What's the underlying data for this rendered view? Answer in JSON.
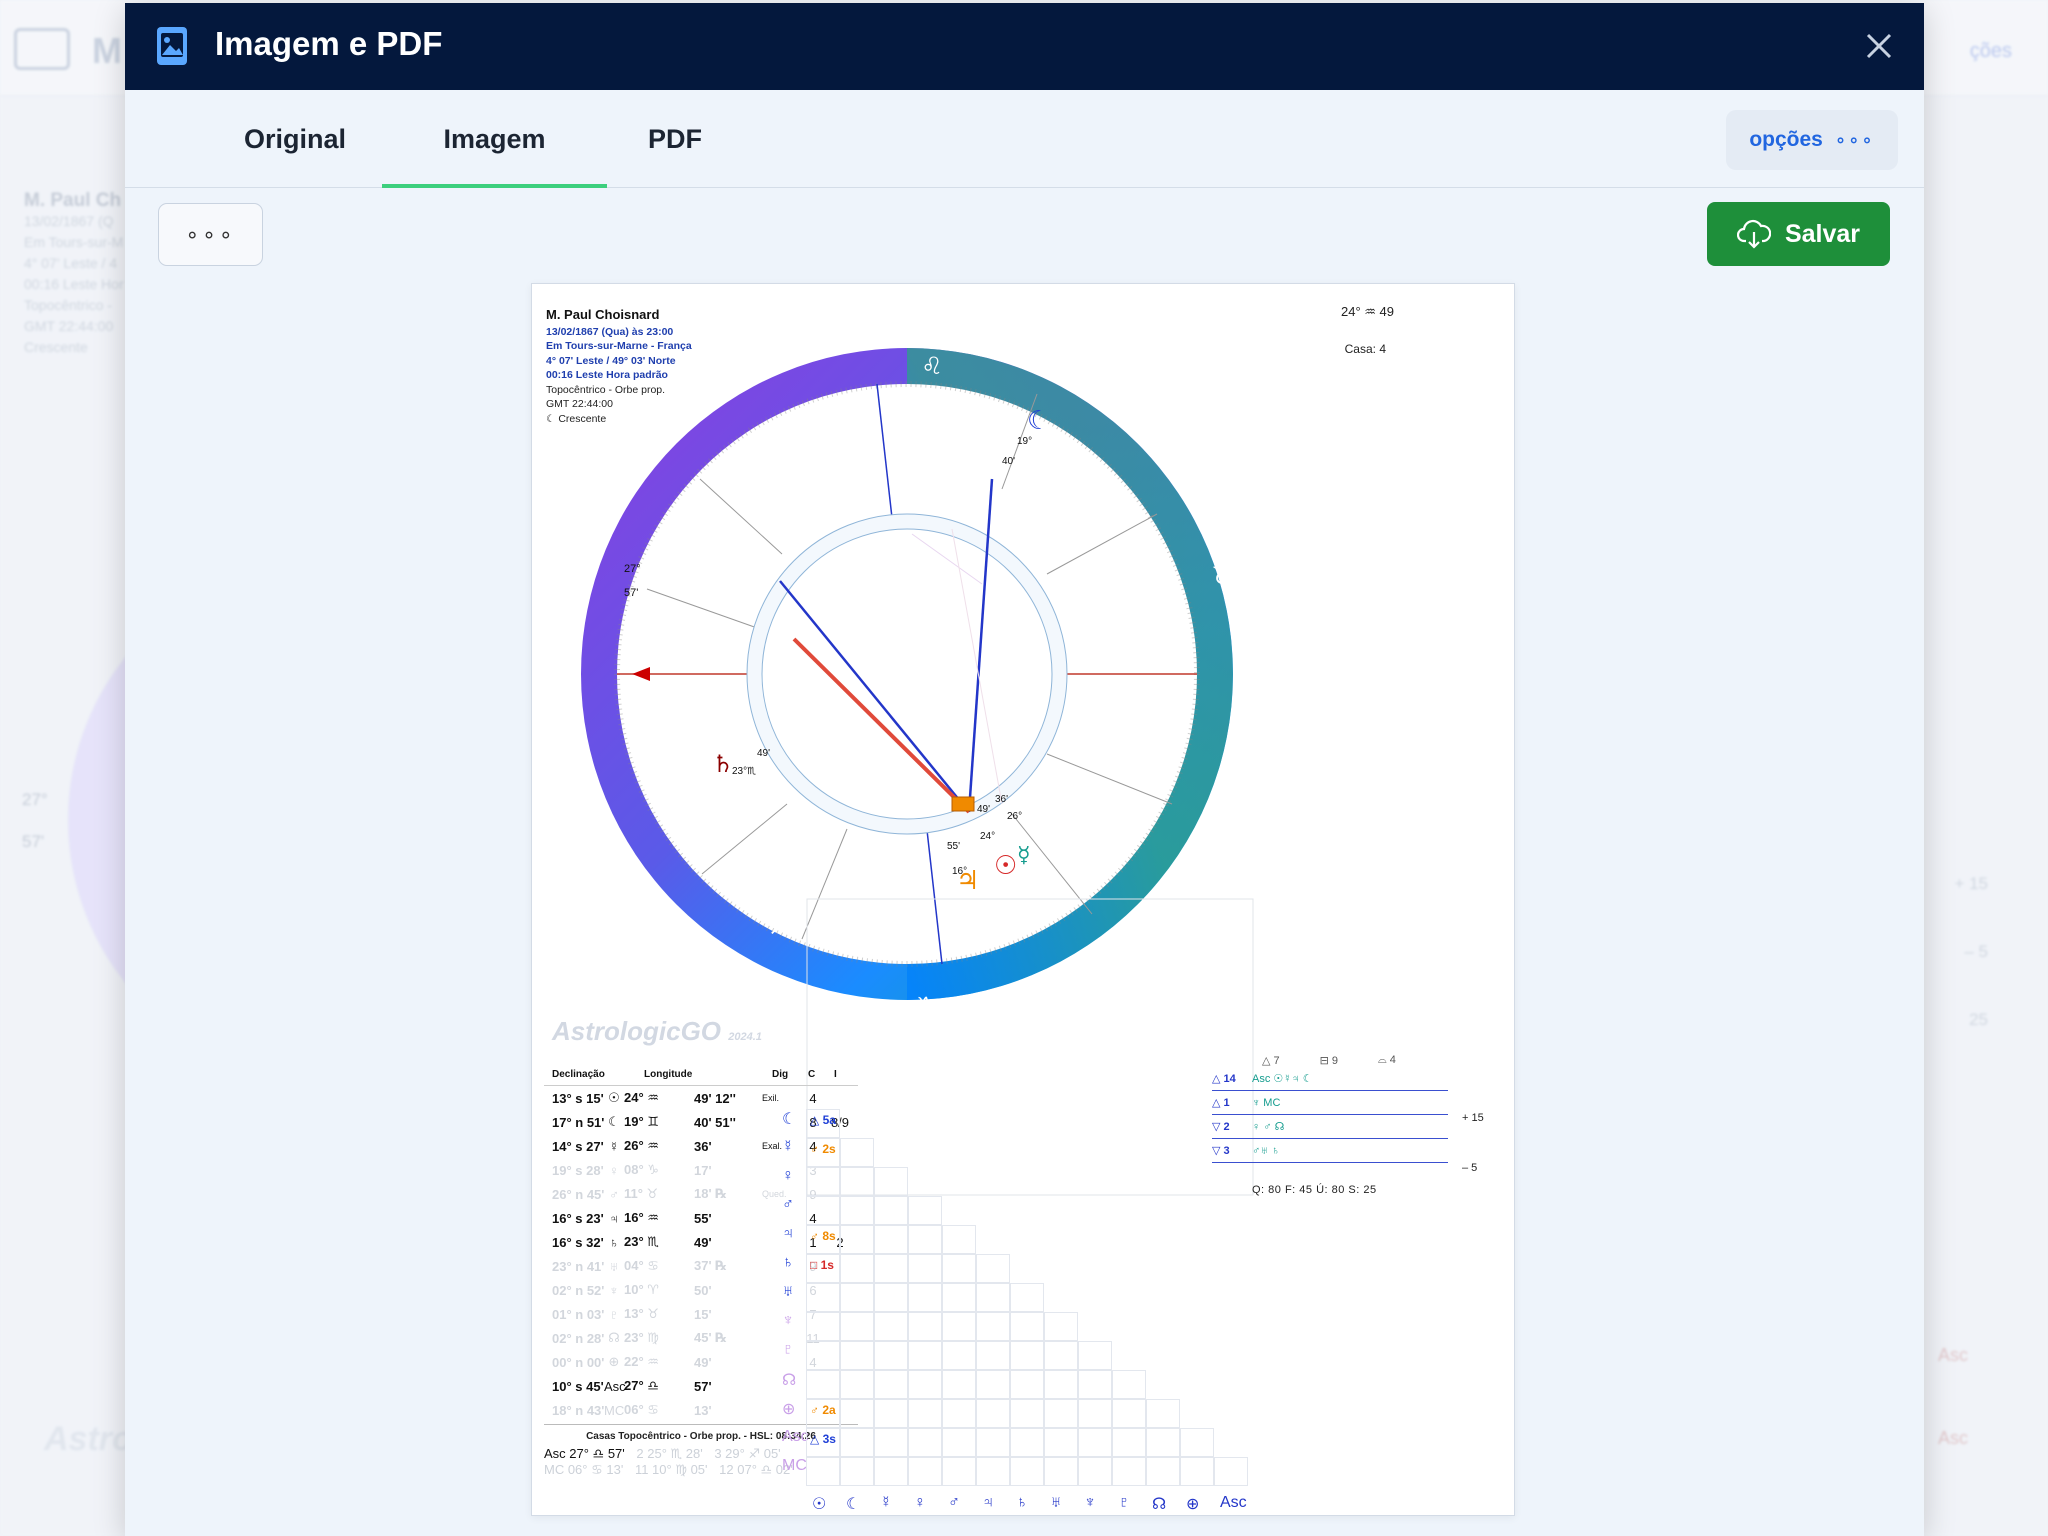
{
  "background": {
    "app_title": "M",
    "options_label": "ções",
    "person": "M. Paul Ch",
    "lines": [
      "13/02/1867 (Q",
      "Em Tours-sur-M",
      "4° 07' Leste / 4",
      "00:16 Leste Hor",
      "Topocêntrico -",
      "GMT 22:44:00",
      "Crescente"
    ],
    "asc_deg": "27°",
    "asc_min": "57'",
    "right_vals": [
      "+ 15",
      "– 5",
      "25"
    ],
    "asc_a": "Asc",
    "asc_b": "Asc",
    "watermark": "Astro"
  },
  "modal": {
    "title": "Imagem e PDF",
    "tabs": [
      {
        "label": "Original",
        "active": false
      },
      {
        "label": "Imagem",
        "active": true
      },
      {
        "label": "PDF",
        "active": false
      }
    ],
    "options_label": "opções",
    "options_dots": "∘∘∘",
    "more_dots": "∘∘∘",
    "save_label": "Salvar"
  },
  "chart": {
    "name": "M. Paul Choisnard",
    "info": [
      {
        "text": "13/02/1867 (Qua) às 23:00",
        "blue": true
      },
      {
        "text": "Em Tours-sur-Marne - França",
        "blue": true
      },
      {
        "text": "4° 07' Leste / 49° 03' Norte",
        "blue": true
      },
      {
        "text": "00:16 Leste Hora padrão",
        "blue": true
      },
      {
        "text": "Topocêntrico - Orbe prop.",
        "blue": false
      },
      {
        "text": "GMT 22:44:00",
        "blue": false
      },
      {
        "text": "☾ Crescente",
        "blue": false
      }
    ],
    "sun_pos": "24° ♒ 49",
    "casa": "Casa: 4",
    "asc_label": "Asc",
    "asc_deg": "27°",
    "asc_min": "57'",
    "watermark": "AstrologicGO",
    "watermark_ver": "2024.1",
    "accent_colors": {
      "red": "#d62828",
      "blue": "#1f3fd6",
      "teal": "#149c8e",
      "purple": "#6a3fd6",
      "orange": "#f08a00"
    }
  },
  "decl_table": {
    "headers": [
      "Declinação",
      "Longitude",
      "Dig",
      "C",
      "I"
    ],
    "rows": [
      {
        "decl": "13° s 15'",
        "glyph": "☉",
        "lon": "24° ♒",
        "min": "49' 12''",
        "dig": "Exil.",
        "c": "4",
        "i": "",
        "dim": false
      },
      {
        "decl": "17° n 51'",
        "glyph": "☾",
        "lon": "19° ♊",
        "min": "40' 51''",
        "dig": "",
        "c": "8",
        "i": "8/9",
        "dim": false
      },
      {
        "decl": "14° s 27'",
        "glyph": "☿",
        "lon": "26° ♒",
        "min": "36'",
        "dig": "Exal.",
        "c": "4",
        "i": "",
        "dim": false
      },
      {
        "decl": "19° s 28'",
        "glyph": "♀",
        "lon": "08° ♑",
        "min": "17'",
        "dig": "",
        "c": "3",
        "i": "",
        "dim": true
      },
      {
        "decl": "26° n 45'",
        "glyph": "♂",
        "lon": "11° ♉",
        "min": "18' ℞",
        "dig": "Qued.",
        "c": "9",
        "i": "",
        "dim": true
      },
      {
        "decl": "16° s 23'",
        "glyph": "♃",
        "lon": "16° ♒",
        "min": "55'",
        "dig": "",
        "c": "4",
        "i": "",
        "dim": false
      },
      {
        "decl": "16° s 32'",
        "glyph": "♄",
        "lon": "23° ♏",
        "min": "49'",
        "dig": "",
        "c": "1",
        "i": "2",
        "dim": false
      },
      {
        "decl": "23° n 41'",
        "glyph": "♅",
        "lon": "04° ♋",
        "min": "37' ℞",
        "dig": "",
        "c": "9",
        "i": "",
        "dim": true
      },
      {
        "decl": "02° n 52'",
        "glyph": "♆",
        "lon": "10° ♈",
        "min": "50'",
        "dig": "",
        "c": "6",
        "i": "",
        "dim": true
      },
      {
        "decl": "01° n 03'",
        "glyph": "♇",
        "lon": "13° ♉",
        "min": "15'",
        "dig": "",
        "c": "7",
        "i": "",
        "dim": true
      },
      {
        "decl": "02° n 28'",
        "glyph": "☊",
        "lon": "23° ♍",
        "min": "45' ℞",
        "dig": "",
        "c": "11",
        "i": "",
        "dim": true
      },
      {
        "decl": "00° n 00'",
        "glyph": "⊕",
        "lon": "22° ♒",
        "min": "49'",
        "dig": "",
        "c": "4",
        "i": "",
        "dim": true
      },
      {
        "decl": "10° s 45'",
        "glyph": "Asc",
        "lon": "27° ♎",
        "min": "57'",
        "dig": "",
        "c": "",
        "i": "",
        "dim": false
      },
      {
        "decl": "18° n 43'",
        "glyph": "MC",
        "lon": "06° ♋",
        "min": "13'",
        "dig": "",
        "c": "",
        "i": "",
        "dim": true
      }
    ],
    "casas_caption": "Casas Topocêntrico - Orbe prop. - HSL: 08:34:26",
    "casas_asc": "Asc 27° ♎ 57'",
    "casas_dim": [
      "2 25° ♏ 28'",
      "3 29° ♐ 05'"
    ],
    "casas_mc": "MC 06° ♋ 13'",
    "casas_dim2": [
      "11 10° ♍ 05'",
      "12 07° ♎ 02'"
    ]
  },
  "elements": {
    "top": [
      "△ 7",
      "⊟ 9",
      "⌓ 4"
    ],
    "rows": [
      {
        "label": "△ 14",
        "val": "Asc  ☉☿♃  ☾"
      },
      {
        "label": "△ 1",
        "val": "♆   MC"
      },
      {
        "label": "▽ 2",
        "val": "♀   ♂   ☊"
      },
      {
        "label": "▽ 3",
        "val": "♂♅  ♄"
      }
    ],
    "plus": "+  15",
    "minus": "–   5",
    "quad": "Q: 80   F: 45   Ú: 80   S: 25"
  },
  "aspects_grid": {
    "row_labels": [
      "☾",
      "☿",
      "♀",
      "♂",
      "♃",
      "♄",
      "♅",
      "♆",
      "♇",
      "☊",
      "⊕",
      "Asc",
      "MC"
    ],
    "cells": [
      {
        "row": 0,
        "text": "△ 5a",
        "color": "#1f3fd6"
      },
      {
        "row": 1,
        "text": "♂ 2s",
        "color": "#f08a00"
      },
      {
        "row": 4,
        "text": "♂ 8s",
        "color": "#f08a00"
      },
      {
        "row": 5,
        "text": "□ 1s",
        "color": "#d62828"
      },
      {
        "row": 10,
        "text": "♂ 2a",
        "color": "#f08a00"
      },
      {
        "row": 11,
        "text": "△ 3s",
        "color": "#1f3fd6"
      }
    ],
    "bottom_labels": [
      "☉",
      "☾",
      "☿",
      "♀",
      "♂",
      "♃",
      "♄",
      "♅",
      "♆",
      "♇",
      "☊",
      "⊕",
      "Asc"
    ]
  }
}
